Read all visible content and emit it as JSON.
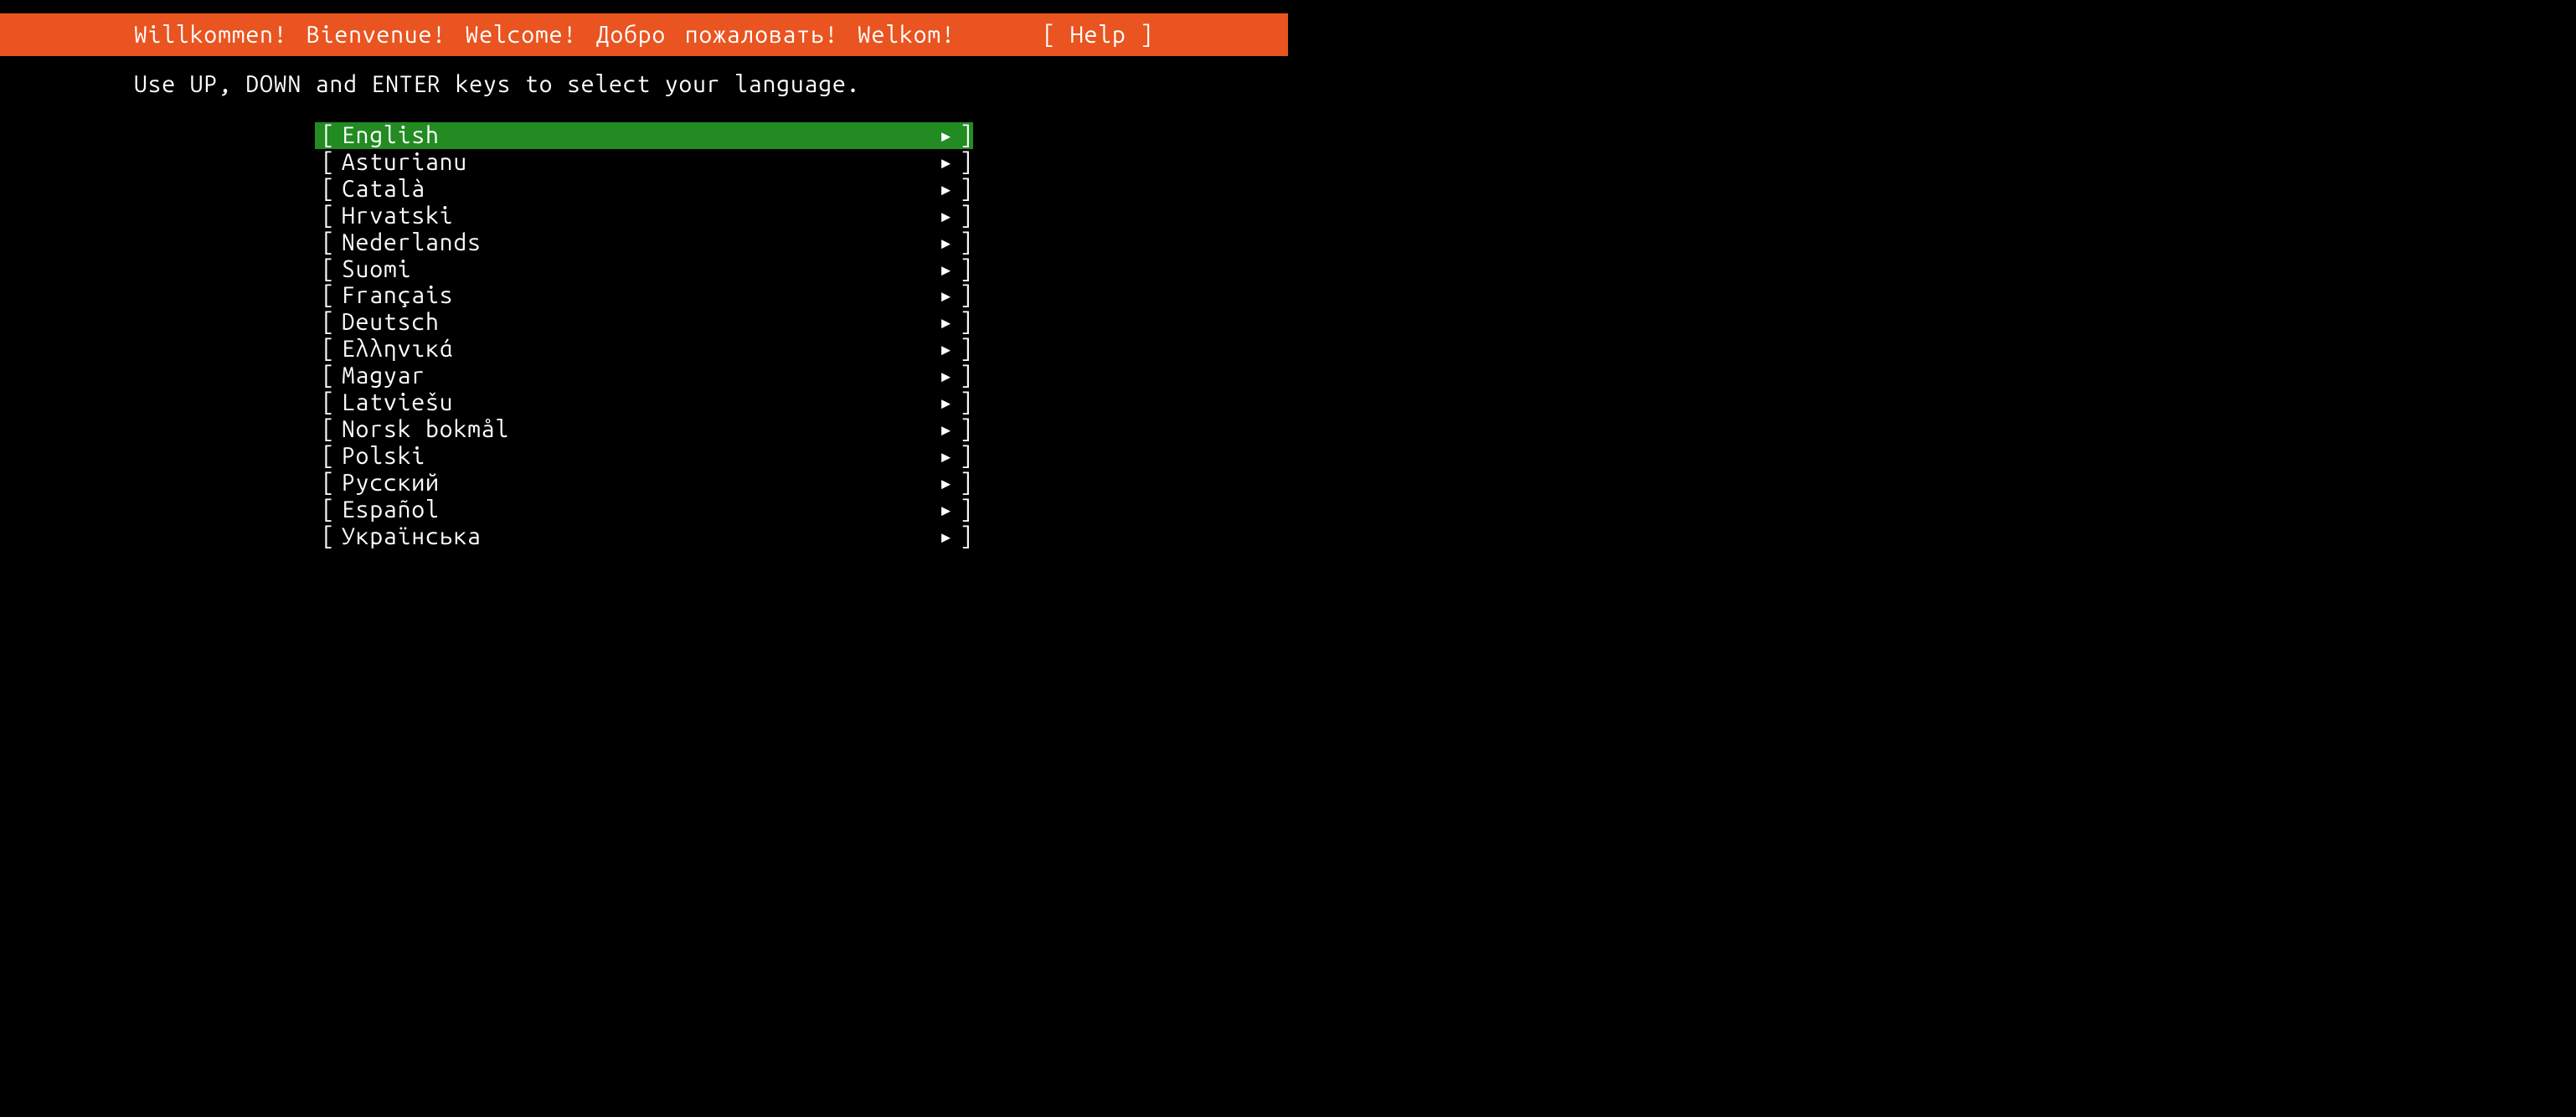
{
  "header": {
    "title": "Willkommen! Bienvenue! Welcome! Добро пожаловать! Welkom!",
    "help_label": "[ Help ]"
  },
  "instruction": "Use UP, DOWN and ENTER keys to select your language.",
  "selected_index": 0,
  "arrow_glyph": "▸",
  "bracket_left": "[",
  "bracket_right": "]",
  "languages": [
    {
      "label": "English"
    },
    {
      "label": "Asturianu"
    },
    {
      "label": "Català"
    },
    {
      "label": "Hrvatski"
    },
    {
      "label": "Nederlands"
    },
    {
      "label": "Suomi"
    },
    {
      "label": "Français"
    },
    {
      "label": "Deutsch"
    },
    {
      "label": "Ελληνικά"
    },
    {
      "label": "Magyar"
    },
    {
      "label": "Latviešu"
    },
    {
      "label": "Norsk bokmål"
    },
    {
      "label": "Polski"
    },
    {
      "label": "Русский"
    },
    {
      "label": "Español"
    },
    {
      "label": "Українська"
    }
  ]
}
